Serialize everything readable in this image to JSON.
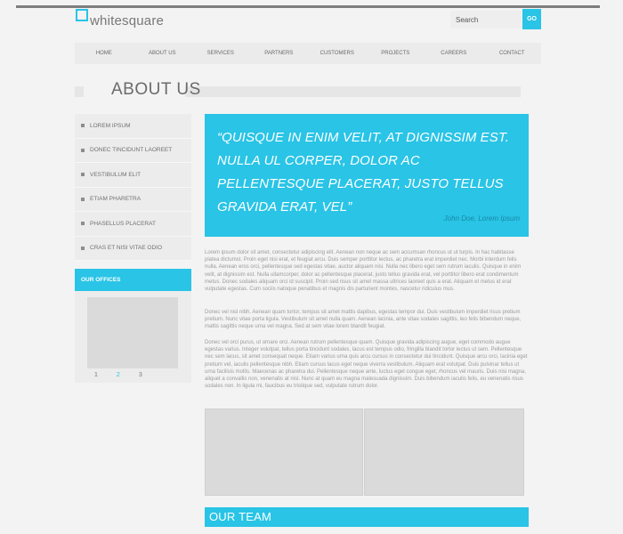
{
  "header": {
    "logo_text": "whitesquare",
    "search_placeholder": "Search",
    "go_label": "GO"
  },
  "nav": {
    "items": [
      "HOME",
      "ABOUT US",
      "SERVICES",
      "PARTNERS",
      "CUSTOMERS",
      "PROJECTS",
      "CAREERS",
      "CONTACT"
    ]
  },
  "page": {
    "title": "ABOUT US"
  },
  "sidebar": {
    "items": [
      "LOREM IPSUM",
      "DONEC TINCIDUNT LAOREET",
      "VESTIBULUM ELIT",
      "ETIAM PHARETRA",
      "PHASELLUS PLACERAT",
      "CRAS ET NISI VITAE ODIO"
    ],
    "offices_title": "OUR OFFICES",
    "pager": [
      "1",
      "2",
      "3"
    ],
    "pager_active": "2"
  },
  "quote": {
    "text": "“Quisque in enim velit, at dignissim est. nulla ul corper, dolor ac pellentesque placerat, justo tellus gravida erat, vel”",
    "author": "John Doe, Lorem Ipsum"
  },
  "content": {
    "paragraph1": "Lorem ipsum dolor sit amet, consectetur adipiscing elit. Aenean non neque ac sem accumsan rhoncus ut ut turpis. In hac habitasse platea dictumst. Proin eget nisi erat, et feugiat arcu. Duis semper porttitor lectus, ac pharetra erat imperdiet nec. Morbi interdum felis nulla. Aenean eros orci, pellentesque sed egestas vitae, auctor aliquam nisi. Nulla nec libero eget sem rutrum iaculis. Quisque in enim velit, at dignissim est. Nulla ullamcorper, dolor ac pellentesque placerat, justo tellus gravida erat, vel porttitor libero erat condimentum metus. Donec sodales aliquam orci id suscipit. Proin sed risus sit amet massa ultrices laoreet quis a erat. Aliquam et metus id erat vulputate egestas. Cum sociis natoque penatibus et magnis dis parturient montes, nascetur ridiculus mus.",
    "paragraph2": "Donec vel nisl nibh. Aenean quam tortor, tempus sit amet mattis dapibus, egestas tempor dui. Duis vestibulum imperdiet risus pretium pretium. Nunc vitae porta ligula. Vestibulum sit amet nulla quam. Aenean lacinia, ante vitae sodales sagittis, leo felis bibendum neque, mattis sagittis neque urna vel magna. Sed at sem vitae lorem blandit feugiat.",
    "paragraph3": "Donec vel orci purus, ut ornare orci. Aenean rutrum pellentesque quam. Quisque gravida adipiscing augue, eget commodo augue egestas varius. Integer volutpat, tellus porta tincidunt sodales, lacus est tempus odio, fringilla blandit tortor lectus ut sem. Pellentesque nec sem lacus, sit amet consequat neque. Etiam varius urna quis arcu cursus in consectetur dui tincidunt. Quisque arcu orci, lacinia eget pretium vel, iaculis pellentesque nibh. Etiam cursus lacus eget neque viverra vestibulum. Aliquam erat volutpat. Duis pulvinar tellus ut urna facilisis mollis. Maecenas ac pharetra dui. Pellentesque neque ante, luctus eget congue eget, rhoncus vel mauris. Duis nisi magna, aliquet a convallis non, venenatis at nisl. Nunc at quam eu magna malesuada dignissim. Duis bibendum iaculis felis, eu venenatis risus sodales non. In ligula mi, faucibus eu tristique sed, vulputate rutrum dolor.",
    "team_title": "OUR TEAM"
  },
  "colors": {
    "accent": "#29c4e6",
    "background": "#f3f3f3",
    "panel": "#ececec"
  }
}
